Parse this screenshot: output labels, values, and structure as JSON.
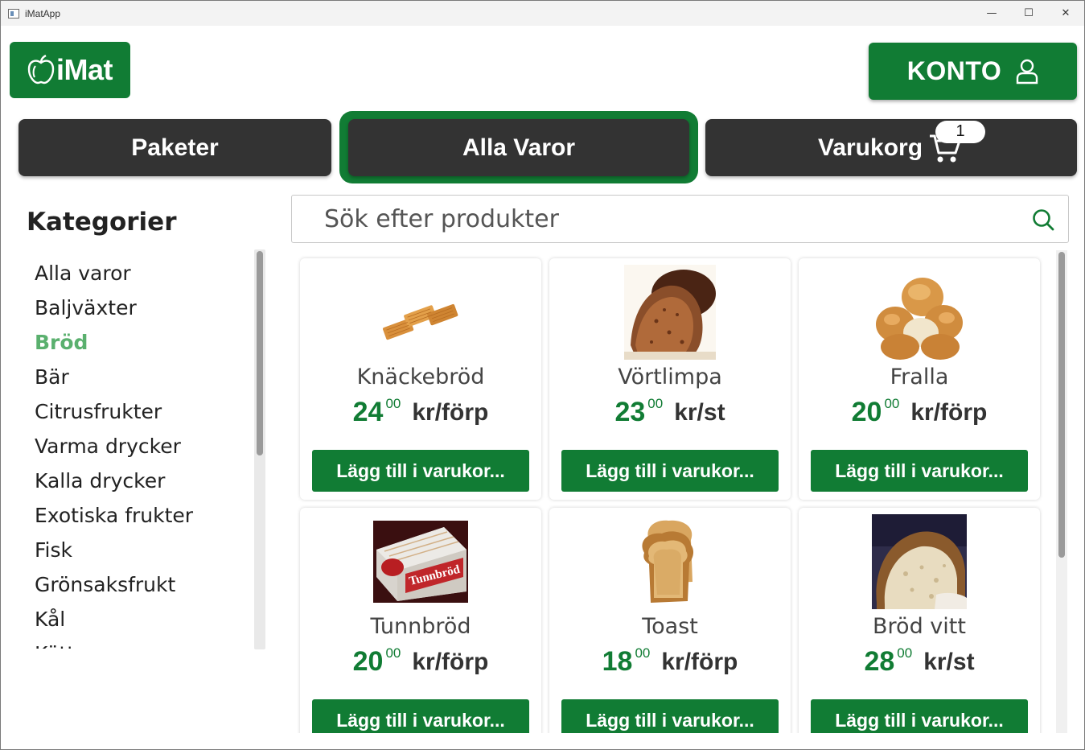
{
  "window": {
    "title": "iMatApp",
    "minimize_glyph": "—",
    "maximize_glyph": "☐",
    "close_glyph": "✕"
  },
  "logo": {
    "text": "iMat",
    "icon": "apple-icon"
  },
  "account": {
    "label": "KONTO",
    "icon": "user-icon"
  },
  "nav": {
    "tabs": [
      {
        "label": "Paketer"
      },
      {
        "label": "Alla Varor",
        "active": true
      },
      {
        "label": "Varukorg",
        "icon": "cart-icon",
        "badge": "1"
      }
    ]
  },
  "sidebar": {
    "title": "Kategorier",
    "items": [
      {
        "label": "Alla varor"
      },
      {
        "label": "Baljväxter"
      },
      {
        "label": "Bröd",
        "active": true
      },
      {
        "label": "Bär"
      },
      {
        "label": "Citrusfrukter"
      },
      {
        "label": "Varma drycker"
      },
      {
        "label": "Kalla drycker"
      },
      {
        "label": "Exotiska frukter"
      },
      {
        "label": "Fisk"
      },
      {
        "label": "Grönsaksfrukt"
      },
      {
        "label": "Kål"
      },
      {
        "label": "Kött"
      }
    ]
  },
  "search": {
    "placeholder": "Sök efter produkter",
    "icon": "search-icon"
  },
  "products": [
    {
      "name": "Knäckebröd",
      "whole": "24",
      "dec": "00",
      "unit": "kr/förp",
      "button": "Lägg till i varukor..."
    },
    {
      "name": "Vörtlimpa",
      "whole": "23",
      "dec": "00",
      "unit": "kr/st",
      "button": "Lägg till i varukor..."
    },
    {
      "name": "Fralla",
      "whole": "20",
      "dec": "00",
      "unit": "kr/förp",
      "button": "Lägg till i varukor..."
    },
    {
      "name": "Tunnbröd",
      "whole": "20",
      "dec": "00",
      "unit": "kr/förp",
      "button": "Lägg till i varukor...",
      "package_text": "Tunnbröd"
    },
    {
      "name": "Toast",
      "whole": "18",
      "dec": "00",
      "unit": "kr/förp",
      "button": "Lägg till i varukor..."
    },
    {
      "name": "Bröd vitt",
      "whole": "28",
      "dec": "00",
      "unit": "kr/st",
      "button": "Lägg till i varukor..."
    }
  ],
  "colors": {
    "brand_green": "#117c34",
    "active_category": "#5ab06e",
    "nav_dark": "#333333"
  }
}
